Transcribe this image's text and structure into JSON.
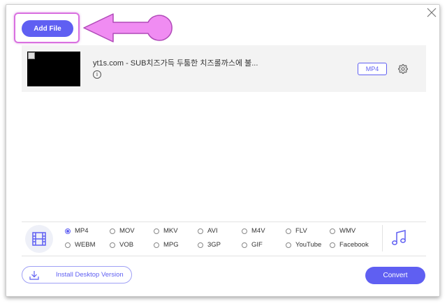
{
  "toolbar": {
    "add_file_label": "Add File"
  },
  "file": {
    "name": "yt1s.com - SUB치즈가득 두툼한 치즈롤까스에 불...",
    "output_format": "MP4",
    "info_glyph": "i"
  },
  "formats": {
    "selected": "MP4",
    "row1": [
      "MP4",
      "MOV",
      "MKV",
      "AVI",
      "M4V",
      "FLV",
      "WMV"
    ],
    "row2": [
      "WEBM",
      "VOB",
      "MPG",
      "3GP",
      "GIF",
      "YouTube",
      "Facebook"
    ]
  },
  "footer": {
    "install_label": "Install Desktop Version",
    "convert_label": "Convert"
  },
  "icons": {
    "close": "close-icon",
    "arrow": "pointer-arrow-icon",
    "info": "info-icon",
    "settings": "gear-icon",
    "video": "film-icon",
    "audio": "music-note-icon",
    "download": "download-icon"
  },
  "colors": {
    "accent": "#5f5ff2",
    "highlight": "#d970e0",
    "arrow_fill": "#f08cf2"
  }
}
